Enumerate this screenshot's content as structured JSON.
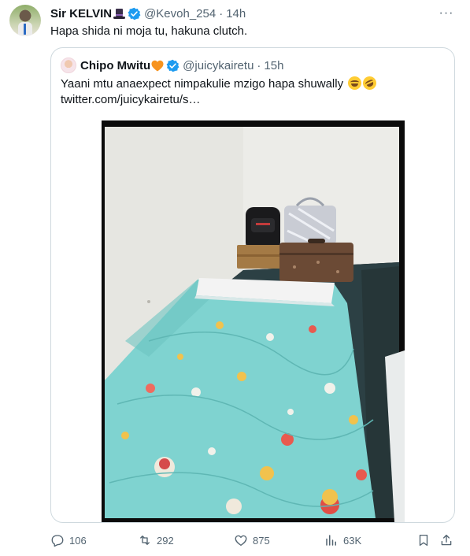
{
  "tweet": {
    "author_name": "Sir KELVIN",
    "author_handle": "@Kevoh_254",
    "separator": "·",
    "time": "14h",
    "text": "Hapa shida ni moja tu, hakuna clutch.",
    "more_label": "···"
  },
  "quoted": {
    "author_name": "Chipo Mwitu",
    "author_handle": "@juicykairetu",
    "separator": "·",
    "time": "15h",
    "text": "Yaani mtu anaexpect nimpakulie mzigo hapa shuwally",
    "link": "twitter.com/juicykairetu/s…"
  },
  "actions": {
    "replies": "106",
    "retweets": "292",
    "likes": "875",
    "views": "63K"
  },
  "colors": {
    "text_primary": "#0f1419",
    "text_secondary": "#536471",
    "verified_blue": "#1d9bf0",
    "border": "#cfd9de"
  }
}
